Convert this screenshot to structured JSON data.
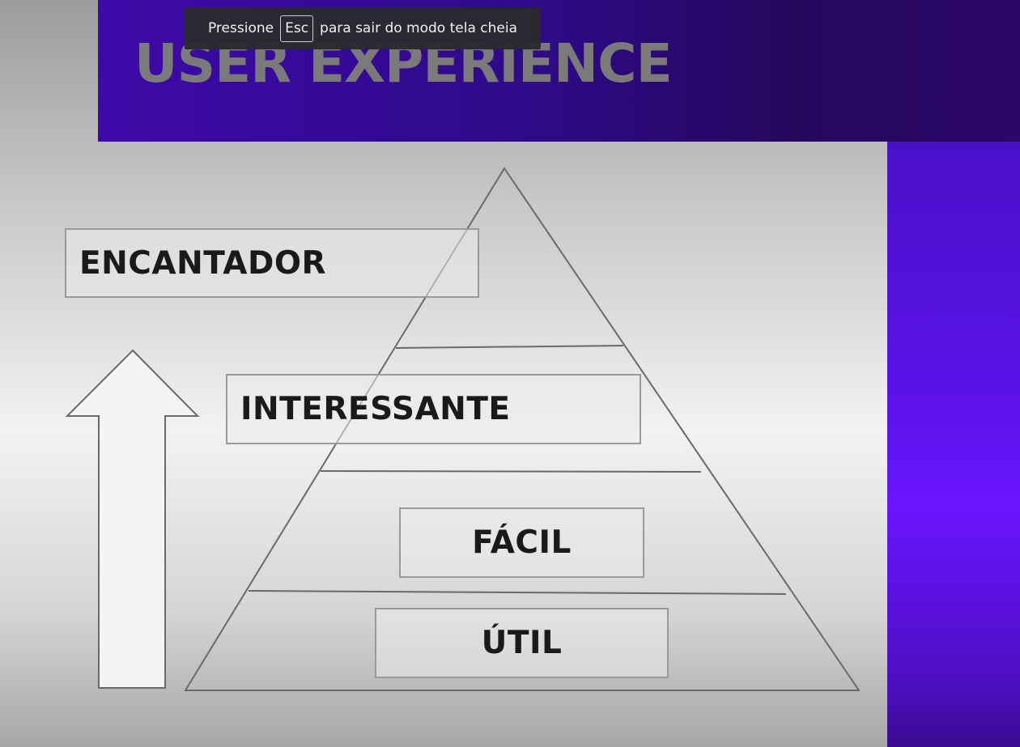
{
  "fullscreen_notice": {
    "before": "Pressione",
    "key": "Esc",
    "after": "para sair do modo tela cheia"
  },
  "slide": {
    "title": "USER EXPERIENCE",
    "levels": [
      {
        "label": "ENCANTADOR"
      },
      {
        "label": "INTERESSANTE"
      },
      {
        "label": "FÁCIL"
      },
      {
        "label": "ÚTIL"
      }
    ]
  },
  "colors": {
    "banner_purple": "#3d0aa8",
    "side_purple": "#6a14ff",
    "title_gray": "#7a7a7a",
    "line_gray": "#6a6a6a"
  }
}
